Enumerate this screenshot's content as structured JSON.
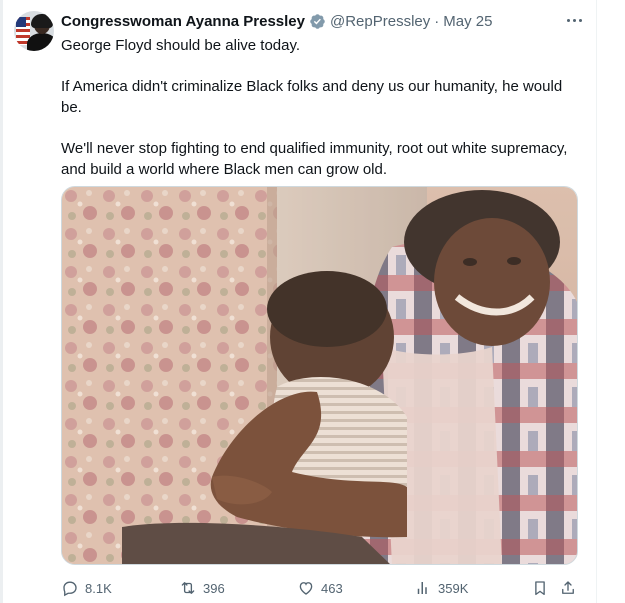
{
  "tweet": {
    "author_name": "Congresswoman Ayanna Pressley",
    "handle": "@RepPressley",
    "separator": "·",
    "date": "May 25",
    "avatar_icon": "profile-avatar",
    "verified_icon": "verified-badge-icon",
    "paragraphs": [
      "George Floyd should be alive today.",
      "If America didn't criminalize Black folks and deny us our humanity, he would be.",
      "We'll never stop fighting to end qualified immunity, root out white supremacy, and build a world where Black men can grow old."
    ],
    "media": {
      "type": "photo",
      "icon": "photo"
    }
  },
  "actions": {
    "replies": "8.1K",
    "retweets": "396",
    "likes": "463",
    "views": "359K",
    "bookmark_icon": "bookmark-icon",
    "share_icon": "share-icon"
  },
  "colors": {
    "text": "#0f1419",
    "secondary": "#536471",
    "verified": "#829aab",
    "border": "#cfd9de"
  }
}
